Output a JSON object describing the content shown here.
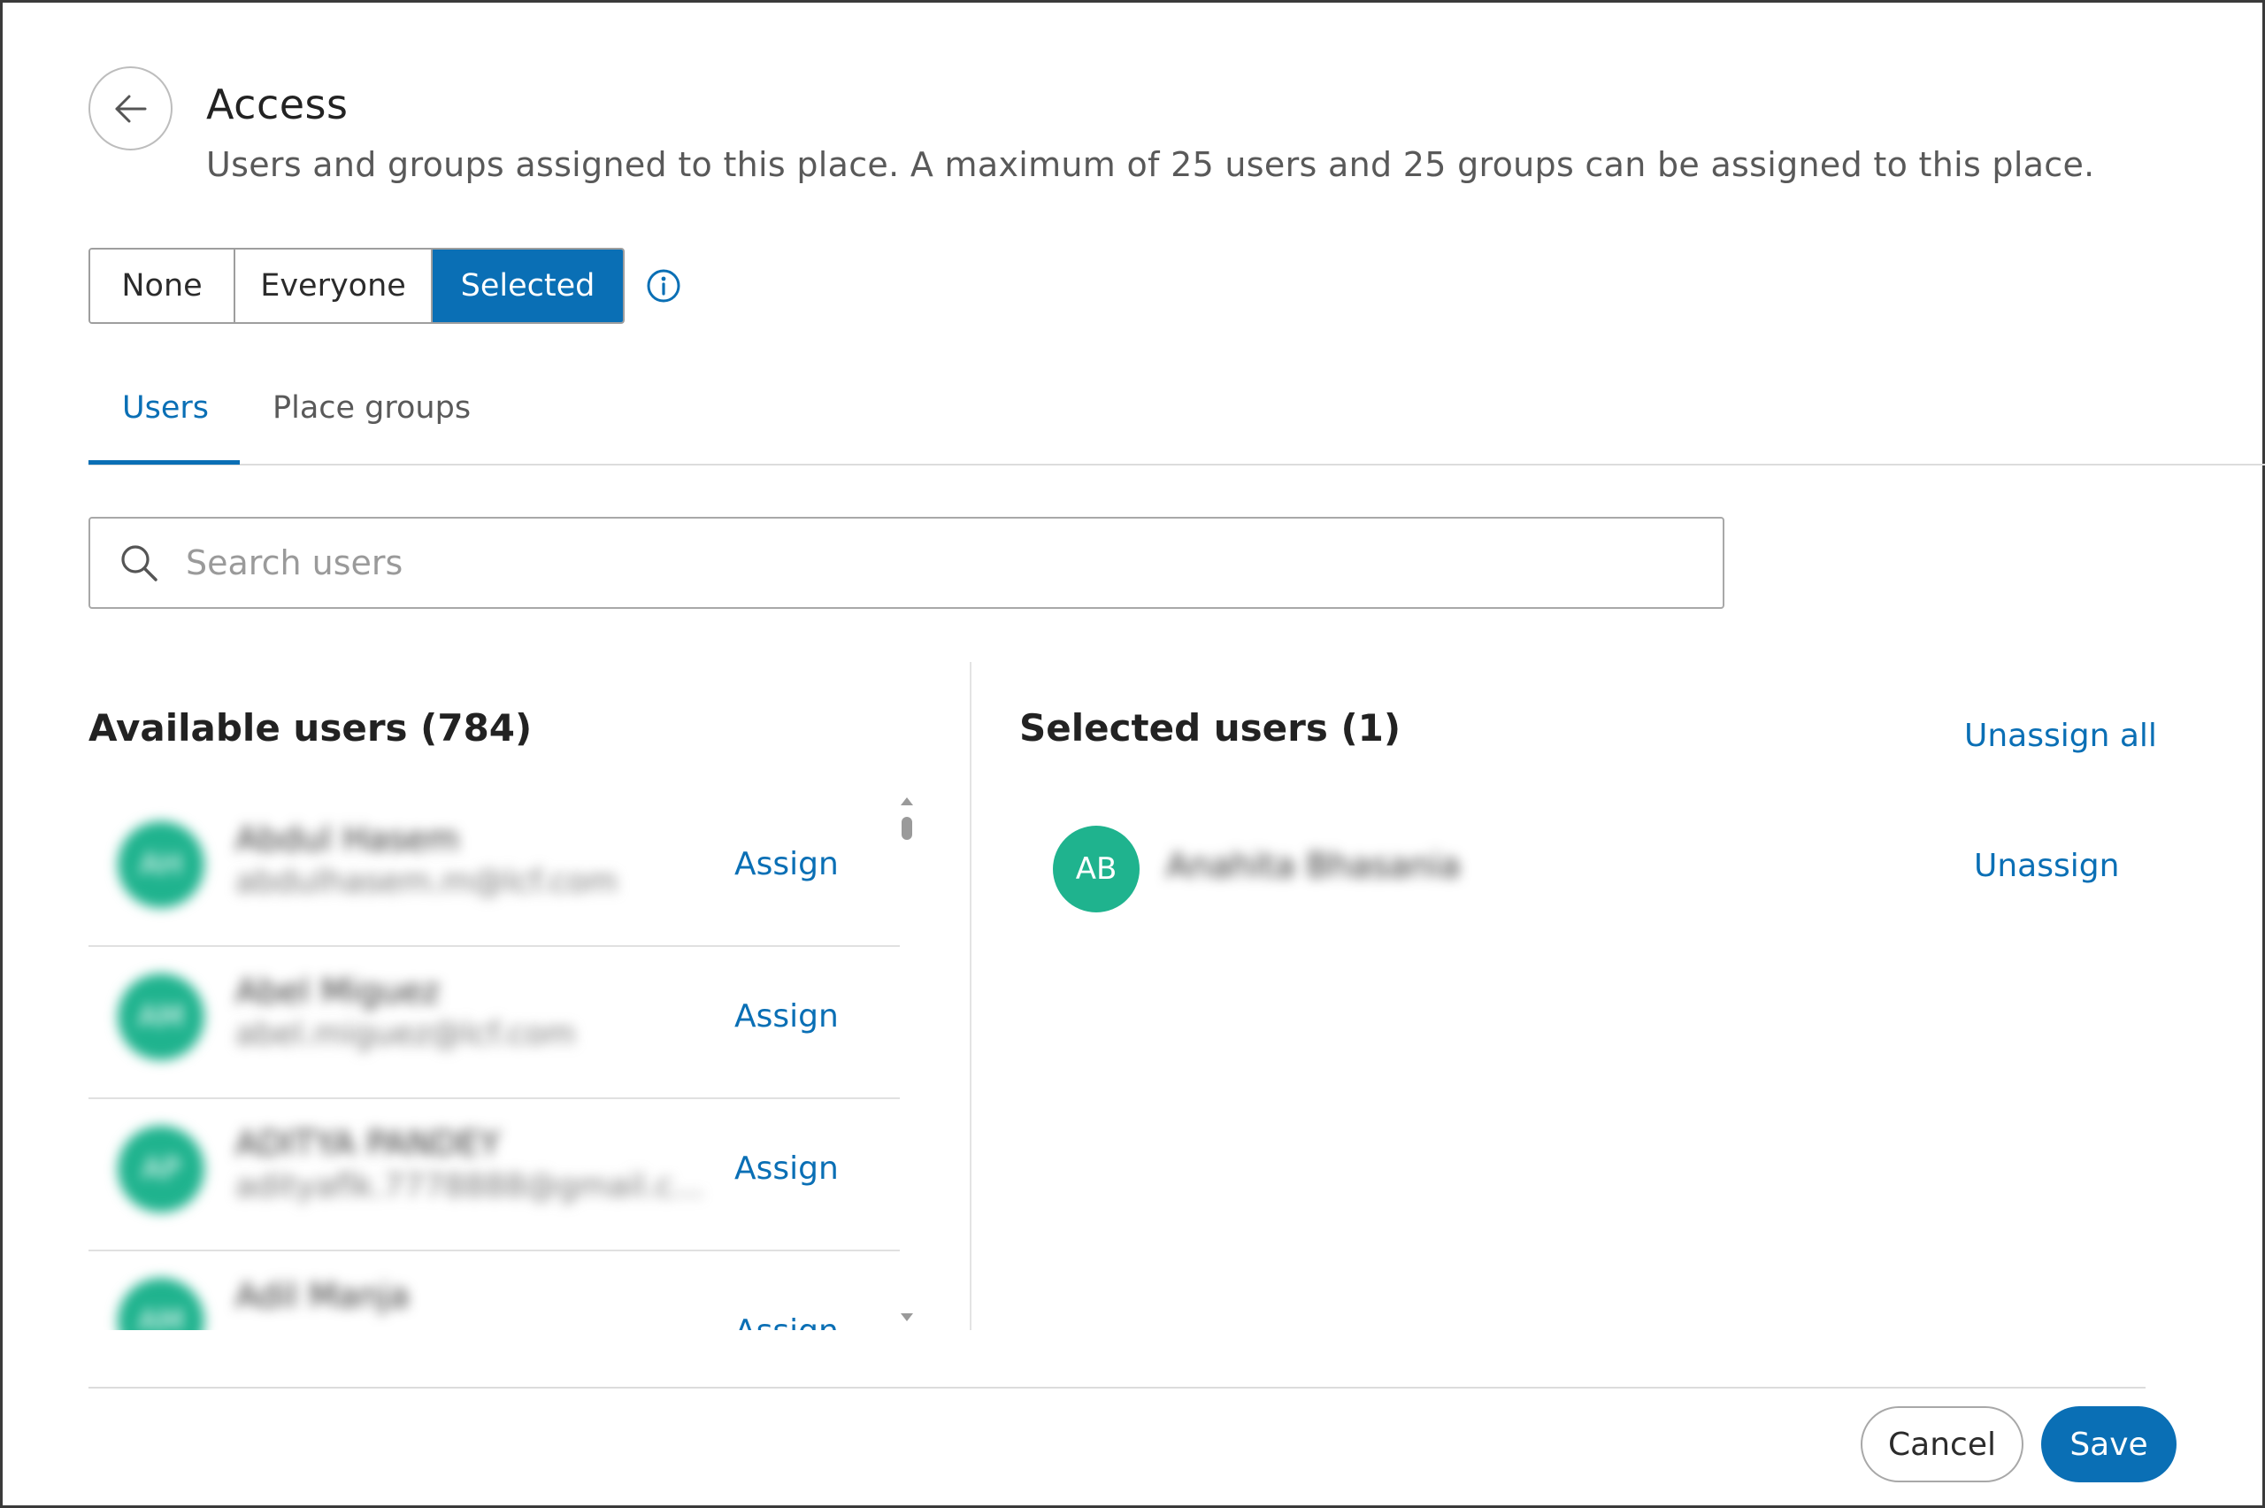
{
  "header": {
    "title": "Access",
    "subtitle": "Users and groups assigned to this place. A maximum of 25 users and 25 groups can be assigned to this place."
  },
  "access_mode": {
    "options": [
      "None",
      "Everyone",
      "Selected"
    ],
    "selected": "Selected"
  },
  "tabs": [
    {
      "label": "Users",
      "active": true
    },
    {
      "label": "Place groups",
      "active": false
    }
  ],
  "search": {
    "placeholder": "Search users",
    "value": ""
  },
  "available": {
    "title": "Available users (784)",
    "assign_label": "Assign",
    "users": [
      {
        "initials": "AH",
        "name": "Abdul Hasem",
        "email": "abdulhasem.m@lcf.com"
      },
      {
        "initials": "AM",
        "name": "Abel Miguez",
        "email": "abel.miguez@lcf.com"
      },
      {
        "initials": "AP",
        "name": "ADITYA PANDEY",
        "email": "adityaflk.7778888@gmail.c..."
      },
      {
        "initials": "AM",
        "name": "Adil Manja",
        "email": ""
      }
    ]
  },
  "selected": {
    "title": "Selected users (1)",
    "unassign_all_label": "Unassign all",
    "unassign_label": "Unassign",
    "users": [
      {
        "initials": "AB",
        "name": "Anahita Bhasania"
      }
    ]
  },
  "footer": {
    "cancel_label": "Cancel",
    "save_label": "Save"
  },
  "colors": {
    "accent": "#0a6fb5",
    "avatar": "#1fb38e"
  }
}
